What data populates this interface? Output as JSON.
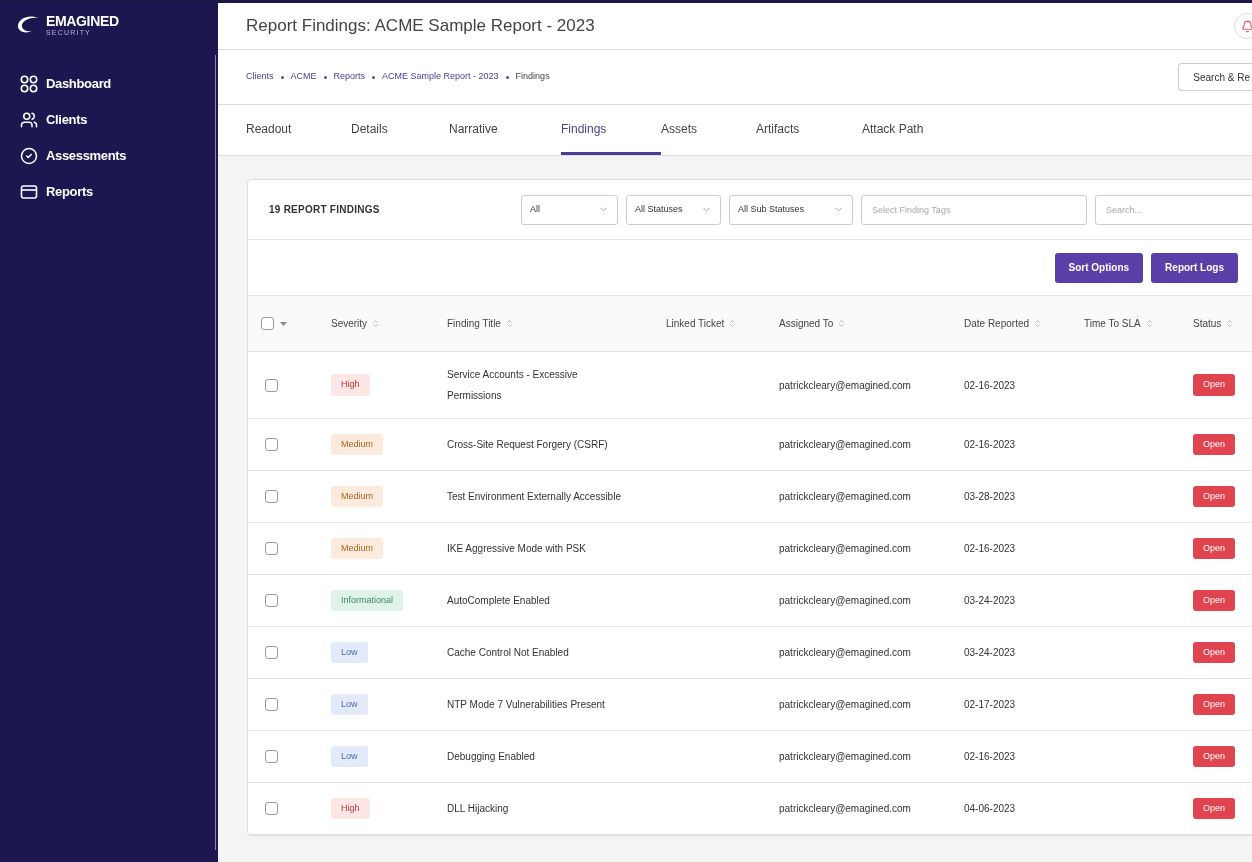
{
  "sidebar": {
    "logo": {
      "name": "EMAGINED",
      "tagline": "SECURITY"
    },
    "items": [
      {
        "label": "Dashboard",
        "kind": "grid"
      },
      {
        "label": "Clients",
        "kind": "people"
      },
      {
        "label": "Assessments",
        "kind": "check"
      },
      {
        "label": "Reports",
        "kind": "folder"
      }
    ]
  },
  "header": {
    "title": "Report Findings: ACME Sample Report - 2023"
  },
  "breadcrumb": [
    "Clients",
    "ACME",
    "Reports",
    "ACME Sample Report - 2023",
    "Findings"
  ],
  "search_replace_button": "Search & Re",
  "tabs": [
    {
      "label": "Readout",
      "selected": false
    },
    {
      "label": "Details",
      "selected": false
    },
    {
      "label": "Narrative",
      "selected": false
    },
    {
      "label": "Findings",
      "selected": true
    },
    {
      "label": "Assets",
      "selected": false
    },
    {
      "label": "Artifacts",
      "selected": false
    },
    {
      "label": "Attack Path",
      "selected": false
    }
  ],
  "card": {
    "count_title": "19 REPORT FINDINGS",
    "filters": [
      {
        "kind": "select",
        "value": "All"
      },
      {
        "kind": "select",
        "value": "All Statuses"
      },
      {
        "kind": "select",
        "value": "All Sub Statuses"
      },
      {
        "kind": "input",
        "placeholder": "Select Finding Tags"
      },
      {
        "kind": "input",
        "placeholder": "Search..."
      }
    ],
    "buttons": [
      "Sort Options",
      "Report Logs"
    ]
  },
  "table": {
    "select_all_checked": false,
    "columns": [
      "Severity",
      "Finding Title",
      "Linked Ticket",
      "Assigned To",
      "Date Reported",
      "Time To SLA",
      "Status"
    ],
    "rows": [
      {
        "checked": false,
        "severity": {
          "label": "High",
          "kind": "high"
        },
        "title": "Service Accounts - Excessive Permissions",
        "assigned_to": "patrickcleary@emagined.com",
        "date": "02-16-2023",
        "status": "Open"
      },
      {
        "checked": false,
        "severity": {
          "label": "Medium",
          "kind": "medium"
        },
        "title": "Cross-Site Request Forgery (CSRF)",
        "assigned_to": "patrickcleary@emagined.com",
        "date": "02-16-2023",
        "status": "Open"
      },
      {
        "checked": false,
        "severity": {
          "label": "Medium",
          "kind": "medium"
        },
        "title": "Test Environment Externally Accessible",
        "assigned_to": "patrickcleary@emagined.com",
        "date": "03-28-2023",
        "status": "Open"
      },
      {
        "checked": false,
        "severity": {
          "label": "Medium",
          "kind": "medium"
        },
        "title": "IKE Aggressive Mode with PSK",
        "assigned_to": "patrickcleary@emagined.com",
        "date": "02-16-2023",
        "status": "Open"
      },
      {
        "checked": false,
        "severity": {
          "label": "Informational",
          "kind": "informational"
        },
        "title": "AutoComplete Enabled",
        "assigned_to": "patrickcleary@emagined.com",
        "date": "03-24-2023",
        "status": "Open"
      },
      {
        "checked": false,
        "severity": {
          "label": "Low",
          "kind": "low"
        },
        "title": "Cache Control Not Enabled",
        "assigned_to": "patrickcleary@emagined.com",
        "date": "03-24-2023",
        "status": "Open"
      },
      {
        "checked": false,
        "severity": {
          "label": "Low",
          "kind": "low"
        },
        "title": "NTP Mode 7 Vulnerabilities Present",
        "assigned_to": "patrickcleary@emagined.com",
        "date": "02-17-2023",
        "status": "Open"
      },
      {
        "checked": false,
        "severity": {
          "label": "Low",
          "kind": "low"
        },
        "title": "Debugging Enabled",
        "assigned_to": "patrickcleary@emagined.com",
        "date": "02-16-2023",
        "status": "Open"
      },
      {
        "checked": false,
        "severity": {
          "label": "High",
          "kind": "high"
        },
        "title": "DLL Hijacking",
        "assigned_to": "patrickcleary@emagined.com",
        "date": "04-06-2023",
        "status": "Open"
      }
    ]
  }
}
